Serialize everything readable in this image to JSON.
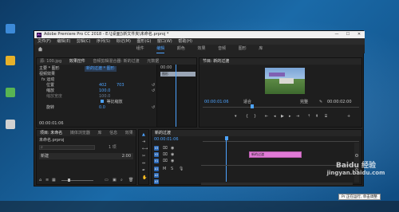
{
  "window": {
    "title": "Adobe Premiere Pro CC 2018 - E:\\[桌面]\\新文件夹\\未命名.prproj *",
    "logo_text": "Pr",
    "min": "—",
    "max": "☐",
    "close": "✕"
  },
  "menu": [
    "文件(F)",
    "编辑(E)",
    "剪辑(C)",
    "序列(S)",
    "标记(M)",
    "图形(G)",
    "窗口(W)",
    "帮助(H)"
  ],
  "workspaces": [
    {
      "label": "组件",
      "active": false
    },
    {
      "label": "编辑",
      "active": true
    },
    {
      "label": "颜色",
      "active": false
    },
    {
      "label": "效果",
      "active": false
    },
    {
      "label": "音频",
      "active": false
    },
    {
      "label": "图形",
      "active": false
    },
    {
      "label": "库",
      "active": false
    }
  ],
  "effect_controls": {
    "tabs": [
      "源: 100.jpg",
      "效果控件",
      "音频剪辑混合器: 新的过渡",
      "元数据"
    ],
    "active_tab": "效果控件",
    "source_line": "主要 * 图形",
    "sequence_line": "新的过渡 * 图形",
    "section_video": "视频效果",
    "fx_motion": "运动",
    "rows": [
      {
        "label": "位置",
        "v1": "402",
        "v2": "703"
      },
      {
        "label": "缩放",
        "v1": "100.0",
        "v2": ""
      },
      {
        "label": "缩放宽度",
        "v1": "100.0",
        "v2": ""
      },
      {
        "label": "等比缩放",
        "v1": "",
        "v2": ""
      },
      {
        "label": "旋转",
        "v1": "0.0",
        "v2": ""
      }
    ],
    "mini_time": "00:00",
    "mini_clip": "图形",
    "bottom_tc": "00:00:01:06"
  },
  "program_monitor": {
    "tab": "节目: 新的过渡",
    "timecode_left": "00:00:01:06",
    "fit": "适合",
    "quality": "完整",
    "timecode_right": "00:00:02:00"
  },
  "project": {
    "tabs": [
      "项目: 未命名",
      "媒体浏览器",
      "库",
      "信息",
      "效果"
    ],
    "file": "未命名.prproj",
    "count": "1 项",
    "item": "新建",
    "item_time": "2:00"
  },
  "timeline": {
    "tab": "新的过渡",
    "timecode": "00:00:01:06",
    "clip_label": "新的过渡",
    "tracks": [
      "V3",
      "V2",
      "V1",
      "A1",
      "A2",
      "A3"
    ]
  },
  "tooltip": "Pr 正在运行, 单击调整",
  "watermark": "Baidu 经验",
  "watermark_url": "jingyan.baidu.com",
  "colors": {
    "accent": "#4da3ff",
    "clip": "#e07ad6",
    "panel": "#1e1e1e"
  }
}
